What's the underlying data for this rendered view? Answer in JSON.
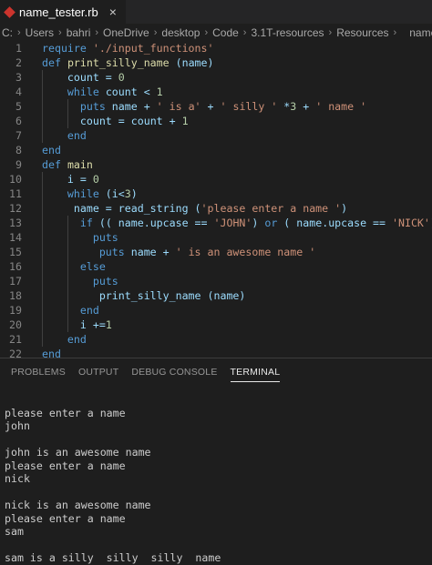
{
  "tab": {
    "filename": "name_tester.rb",
    "close": "×"
  },
  "breadcrumb": [
    "C:",
    "Users",
    "bahri",
    "OneDrive",
    "desktop",
    "Code",
    "3.1T-resources",
    "Resources",
    "name_teste"
  ],
  "editor": {
    "line_numbers": [
      "1",
      "2",
      "3",
      "4",
      "5",
      "6",
      "7",
      "8",
      "9",
      "10",
      "11",
      "12",
      "13",
      "14",
      "15",
      "16",
      "17",
      "18",
      "19",
      "20",
      "21",
      "22"
    ],
    "lines": [
      "require './input_functions'",
      "def print_silly_name (name)",
      "    count = 0",
      "    while count < 1",
      "      puts name + ' is a' + ' silly ' *3 + ' name '",
      "      count = count + 1",
      "    end",
      "end",
      "def main",
      "    i = 0",
      "    while (i<3)",
      "     name = read_string ('please enter a name ')",
      "      if (( name.upcase == 'JOHN') or ( name.upcase == 'NICK'))",
      "        puts",
      "         puts name + ' is an awesome name '",
      "      else",
      "        puts",
      "         print_silly_name (name)",
      "      end",
      "      i +=1",
      "    end",
      "end"
    ]
  },
  "panel": {
    "tabs": [
      "PROBLEMS",
      "OUTPUT",
      "DEBUG CONSOLE",
      "TERMINAL"
    ],
    "active_tab": "TERMINAL"
  },
  "terminal": {
    "lines": [
      "",
      "please enter a name",
      "john",
      "",
      "john is an awesome name",
      "please enter a name",
      "nick",
      "",
      "nick is an awesome name",
      "please enter a name",
      "sam",
      "",
      "sam is a silly  silly  silly  name"
    ]
  },
  "colors": {
    "background": "#1e1e1e",
    "keyword": "#569cd6",
    "string": "#ce9178",
    "number": "#b5cea8",
    "variable": "#9cdcfe",
    "function": "#dcdcaa",
    "ruby_icon": "#cc342d"
  }
}
